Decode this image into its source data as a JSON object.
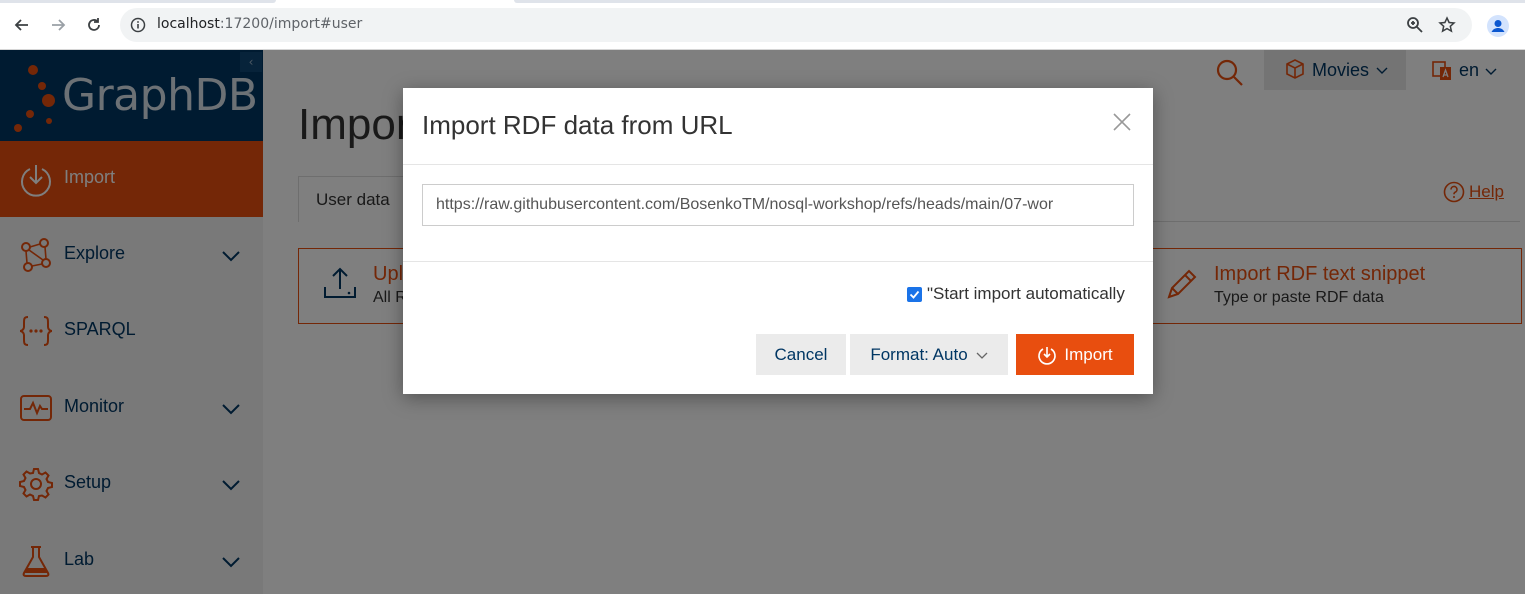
{
  "browser": {
    "url_host": "localhost",
    "url_path": ":17200/import#user"
  },
  "sidebar": {
    "logo_text": "GraphDB",
    "collapse_glyph": "‹",
    "items": [
      {
        "label": "Import",
        "icon": "import-icon",
        "active": true
      },
      {
        "label": "Explore",
        "icon": "explore-icon"
      },
      {
        "label": "SPARQL",
        "icon": "sparql-icon"
      },
      {
        "label": "Monitor",
        "icon": "monitor-icon"
      },
      {
        "label": "Setup",
        "icon": "setup-icon"
      },
      {
        "label": "Lab",
        "icon": "lab-icon"
      }
    ]
  },
  "header": {
    "repository": "Movies",
    "language": "en"
  },
  "main": {
    "title": "Import",
    "tab_user_data": "User data",
    "help_label": "Help",
    "cards": [
      {
        "title": "Upload RDF files",
        "subtitle": "All RDF formats"
      },
      {
        "title": "Import RDF text snippet",
        "subtitle": "Type or paste RDF data"
      }
    ]
  },
  "modal": {
    "title": "Import RDF data from URL",
    "url_value": "https://raw.githubusercontent.com/BosenkoTM/nosql-workshop/refs/heads/main/07-wor",
    "auto_start_label": "\"Start import automatically",
    "auto_start_checked": true,
    "cancel_label": "Cancel",
    "format_label": "Format: Auto",
    "import_label": "Import"
  },
  "colors": {
    "accent": "#e84e0f",
    "navy": "#003663"
  }
}
